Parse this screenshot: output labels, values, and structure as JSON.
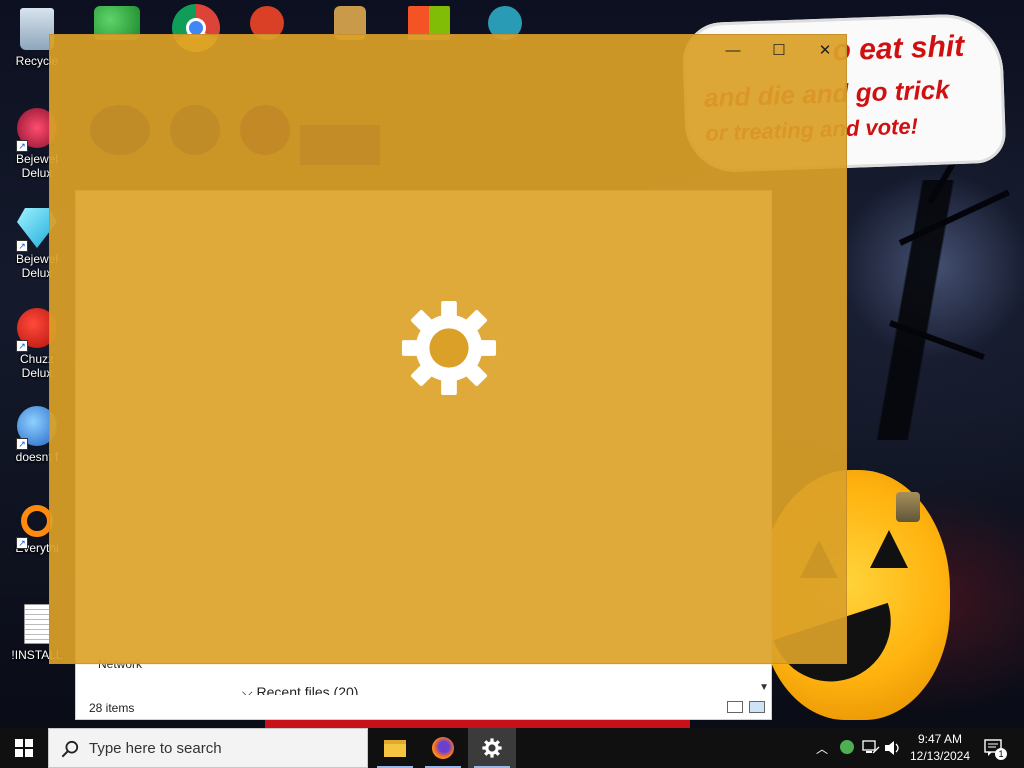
{
  "desktop_icons_left": [
    {
      "label": "Recycle"
    },
    {
      "label": "Bejewel\nDelux"
    },
    {
      "label": "Bejewel\nDelux"
    },
    {
      "label": "Chuzz\nDelux"
    },
    {
      "label": "doesnt f"
    },
    {
      "label": "Everythi"
    },
    {
      "label": "!INSTALL"
    }
  ],
  "sign": {
    "line1": "o eat shit",
    "line2": "and die and go trick",
    "line3": "or treating and vote!"
  },
  "explorer": {
    "network_label": "Network",
    "recent_label": "Recent files (20)",
    "status": "28 items"
  },
  "splash": {
    "minimize": "—",
    "maximize": "☐",
    "close": "✕"
  },
  "taskbar": {
    "search_placeholder": "Type here to search",
    "time": "9:47 AM",
    "date": "12/13/2024",
    "notification_count": "1"
  },
  "colors": {
    "splash_bg": "#daa028",
    "taskbar_bg": "#101010",
    "pumpkin": "#ffb30f"
  }
}
